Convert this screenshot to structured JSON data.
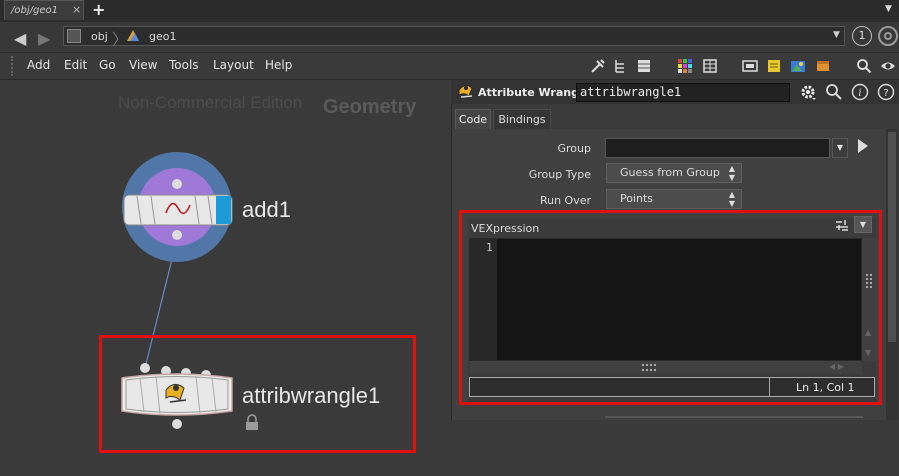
{
  "tabs": {
    "active": "/obj/geo1",
    "close": "×",
    "add": "+",
    "menu": "▼"
  },
  "path": {
    "back": "◀",
    "forward": "▶",
    "obj": "obj",
    "sep": "〉",
    "geo": "geo1",
    "dropdown": "▼",
    "pin": "1"
  },
  "menu": [
    "Add",
    "Edit",
    "Go",
    "View",
    "Tools",
    "Layout",
    "Help"
  ],
  "toolbar_icons": [
    "wrench-icon",
    "tree-icon",
    "list-icon",
    "color-grid-icon",
    "grid-icon",
    "layout-icon",
    "note-icon",
    "image-icon",
    "box-icon",
    "search-icon",
    "eye-icon"
  ],
  "network": {
    "watermark": "Non-Commercial Edition",
    "context": "Geometry",
    "nodes": [
      {
        "name": "add1"
      },
      {
        "name": "attribwrangle1",
        "locked": true
      }
    ]
  },
  "parm": {
    "type_label": "Attribute Wrangle",
    "node_name": "attribwrangle1",
    "tabs": [
      "Code",
      "Bindings"
    ],
    "active_tab": "Code",
    "group_label": "Group",
    "group_value": "",
    "group_type_label": "Group Type",
    "group_type_value": "Guess from Group",
    "run_over_label": "Run Over",
    "run_over_value": "Points",
    "vex_label": "VEXpression",
    "line_number": "1",
    "cursor_pos": "Ln 1, Col 1",
    "updown": "▲▼"
  },
  "colors": {
    "highlight": "#e01010",
    "accent_blue": "#1a9ad8",
    "node_ring": "#5077a8",
    "node_inner": "#a078d8"
  }
}
